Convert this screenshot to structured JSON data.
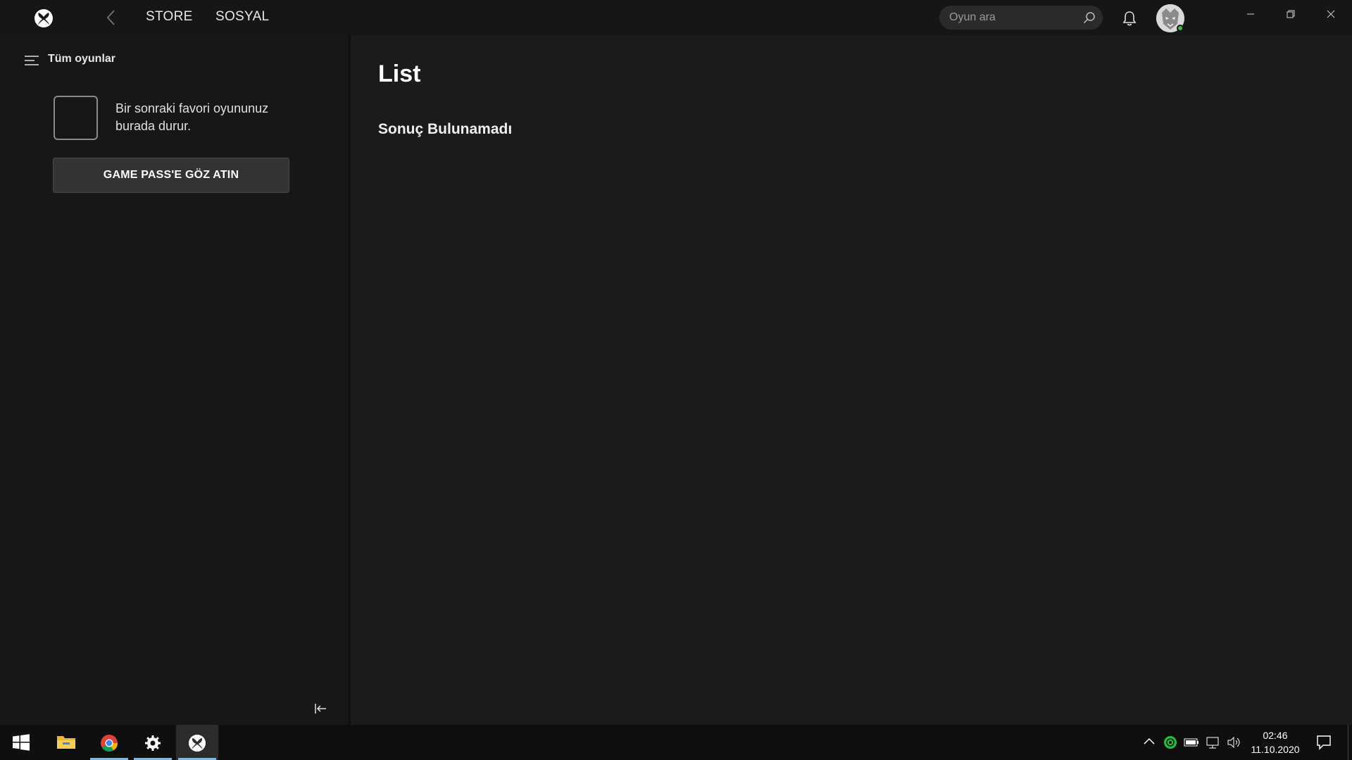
{
  "titlebar": {
    "nav": {
      "store": "STORE",
      "social": "SOSYAL"
    },
    "search": {
      "placeholder": "Oyun ara"
    },
    "icons": [
      "xbox-logo-icon",
      "back-arrow-icon",
      "search-icon",
      "bell-icon",
      "avatar",
      "minimize-icon",
      "restore-icon",
      "close-icon"
    ]
  },
  "sidebar": {
    "filter_label": "Tüm oyunlar",
    "favorite_hint": "Bir sonraki favori oyununuz burada durur.",
    "gamepass_button": "GAME PASS'E GÖZ ATIN"
  },
  "main": {
    "title": "List",
    "empty_message": "Sonuç Bulunamadı"
  },
  "taskbar": {
    "apps": [
      "windows-start-icon",
      "file-explorer-icon",
      "chrome-icon",
      "settings-icon",
      "xbox-icon"
    ],
    "active_app": "xbox-icon",
    "clock": {
      "time": "02:46",
      "date": "11.10.2020"
    }
  },
  "colors": {
    "background": "#1b1b1b",
    "sidebar": "#171717",
    "titlebar": "#161616",
    "button": "#333333",
    "presence": "#3fbf3f",
    "taskbar_indicator": "#76b9ed"
  }
}
